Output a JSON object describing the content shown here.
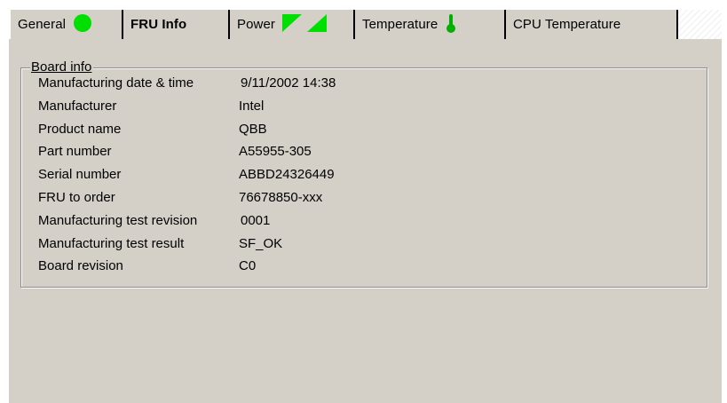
{
  "tabs": [
    {
      "label": "General",
      "icon": "green-circle-icon"
    },
    {
      "label": "FRU Info",
      "active": true
    },
    {
      "label": "Power",
      "icon": "power-triangles-icon"
    },
    {
      "label": "Temperature",
      "icon": "thermometer-icon"
    },
    {
      "label": "CPU Temperature"
    }
  ],
  "colors": {
    "status_green": "#00e000",
    "panel_bg": "#d4d0c8"
  },
  "board_info": {
    "title": "Board info",
    "rows": [
      {
        "label": "Manufacturing date & time",
        "value": "9/11/2002 14:38"
      },
      {
        "label": "Manufacturer",
        "value": "Intel"
      },
      {
        "label": "Product name",
        "value": "QBB"
      },
      {
        "label": "Part number",
        "value": "A55955-305"
      },
      {
        "label": "Serial number",
        "value": "ABBD24326449"
      },
      {
        "label": "FRU to order",
        "value": "76678850-xxx"
      },
      {
        "label": "Manufacturing test revision",
        "value": "0001"
      },
      {
        "label": "Manufacturing test result",
        "value": "SF_OK"
      },
      {
        "label": "Board revision",
        "value": "C0"
      }
    ]
  }
}
